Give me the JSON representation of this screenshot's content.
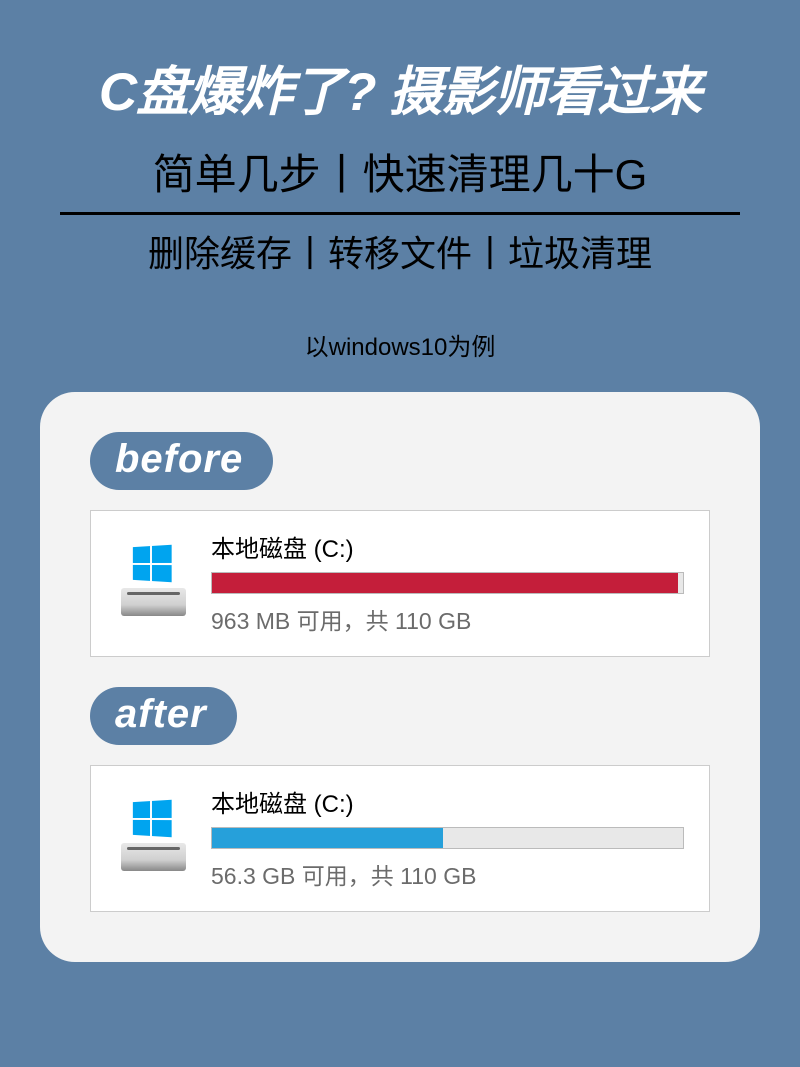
{
  "header": {
    "title": "C盘爆炸了? 摄影师看过来",
    "subtitle": "简单几步丨快速清理几十G",
    "subtitle2": "删除缓存丨转移文件丨垃圾清理",
    "example_note": "以windows10为例"
  },
  "comparison": {
    "before": {
      "badge": "before",
      "disk_label": "本地磁盘 (C:)",
      "free_space": "963 MB",
      "total_space": "110 GB",
      "status_text": "963 MB 可用，共 110 GB",
      "fill_percent": 99,
      "fill_color": "#c41e3a"
    },
    "after": {
      "badge": "after",
      "disk_label": "本地磁盘 (C:)",
      "free_space": "56.3 GB",
      "total_space": "110 GB",
      "status_text": "56.3 GB 可用，共 110 GB",
      "fill_percent": 49,
      "fill_color": "#26a0da"
    }
  }
}
